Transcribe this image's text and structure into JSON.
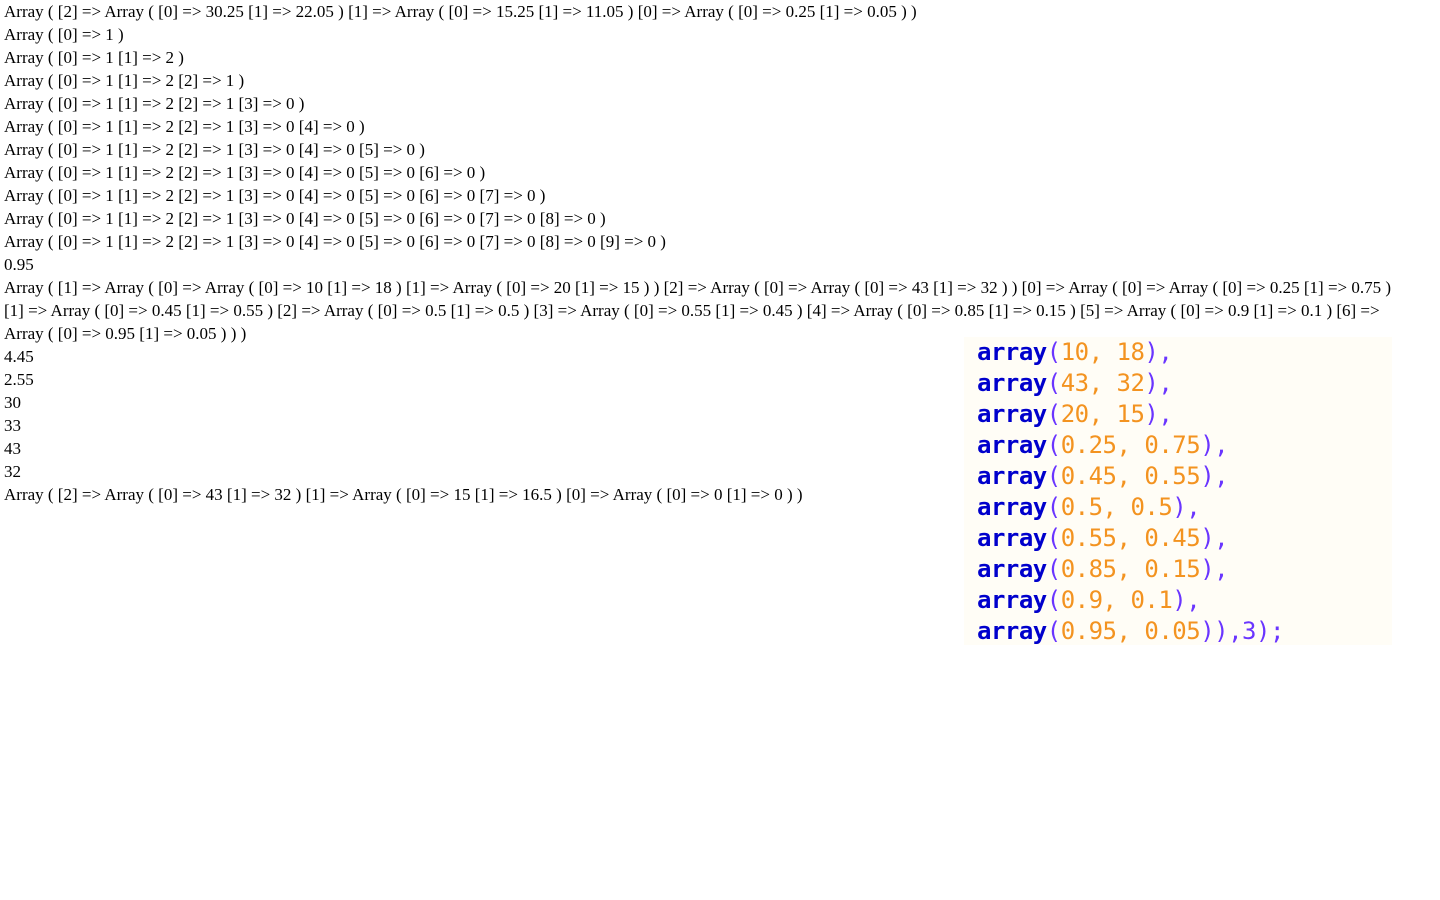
{
  "output_lines": [
    "Array ( [2] => Array ( [0] => 30.25 [1] => 22.05 ) [1] => Array ( [0] => 15.25 [1] => 11.05 ) [0] => Array ( [0] => 0.25 [1] => 0.05 ) )",
    "Array ( [0] => 1 )",
    "Array ( [0] => 1 [1] => 2 )",
    "Array ( [0] => 1 [1] => 2 [2] => 1 )",
    "Array ( [0] => 1 [1] => 2 [2] => 1 [3] => 0 )",
    "Array ( [0] => 1 [1] => 2 [2] => 1 [3] => 0 [4] => 0 )",
    "Array ( [0] => 1 [1] => 2 [2] => 1 [3] => 0 [4] => 0 [5] => 0 )",
    "Array ( [0] => 1 [1] => 2 [2] => 1 [3] => 0 [4] => 0 [5] => 0 [6] => 0 )",
    "Array ( [0] => 1 [1] => 2 [2] => 1 [3] => 0 [4] => 0 [5] => 0 [6] => 0 [7] => 0 )",
    "Array ( [0] => 1 [1] => 2 [2] => 1 [3] => 0 [4] => 0 [5] => 0 [6] => 0 [7] => 0 [8] => 0 )",
    "Array ( [0] => 1 [1] => 2 [2] => 1 [3] => 0 [4] => 0 [5] => 0 [6] => 0 [7] => 0 [8] => 0 [9] => 0 )",
    "0.95"
  ],
  "long_output": "Array ( [1] => Array ( [0] => Array ( [0] => 10 [1] => 18 ) [1] => Array ( [0] => 20 [1] => 15 ) ) [2] => Array ( [0] => Array ( [0] => 43 [1] => 32 ) ) [0] => Array ( [0] => Array ( [0] => 0.25 [1] => 0.75 ) [1] => Array ( [0] => 0.45 [1] => 0.55 ) [2] => Array ( [0] => 0.5 [1] => 0.5 ) [3] => Array ( [0] => 0.55 [1] => 0.45 ) [4] => Array ( [0] => 0.85 [1] => 0.15 ) [5] => Array ( [0] => 0.9 [1] => 0.1 ) [6] => Array ( [0] => 0.95 [1] => 0.05 ) ) )",
  "value_lines": [
    "4.45",
    "2.55",
    "30",
    "33",
    "43",
    "32"
  ],
  "final_output": "Array ( [2] => Array ( [0] => 43 [1] => 32 ) [1] => Array ( [0] => 15 [1] => 16.5 ) [0] => Array ( [0] => 0 [1] => 0 ) )",
  "code_snippet": {
    "keyword": "array",
    "lines": [
      {
        "args": "10, 18",
        "tail": "),"
      },
      {
        "args": "43, 32",
        "tail": "),"
      },
      {
        "args": "20, 15",
        "tail": "),"
      },
      {
        "args": "0.25, 0.75",
        "tail": "),"
      },
      {
        "args": "0.45, 0.55",
        "tail": "),"
      },
      {
        "args": "0.5, 0.5",
        "tail": "),"
      },
      {
        "args": "0.55, 0.45",
        "tail": "),"
      },
      {
        "args": "0.85, 0.15",
        "tail": "),"
      },
      {
        "args": "0.9, 0.1",
        "tail": "),"
      },
      {
        "args": "0.95, 0.05",
        "tail": ")),3);"
      }
    ]
  },
  "colors": {
    "keyword": "#0000cc",
    "punctuation": "#6a35ff",
    "number": "#f39320",
    "panel_background": "#fffdf6"
  }
}
